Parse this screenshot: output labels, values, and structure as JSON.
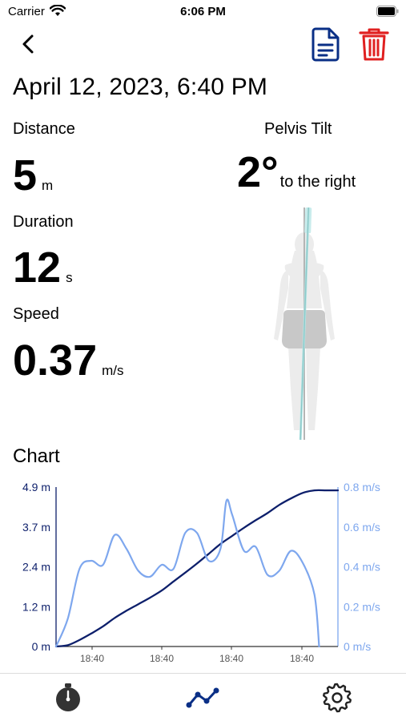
{
  "status_bar": {
    "carrier": "Carrier",
    "time": "6:06 PM"
  },
  "header": {
    "back_icon": "chevron-left-icon",
    "doc_icon": "document-icon",
    "delete_icon": "trash-icon",
    "delete_color": "#e02020",
    "doc_color": "#0a2f86"
  },
  "title": "April 12, 2023, 6:40 PM",
  "stats": {
    "distance": {
      "label": "Distance",
      "value": "5",
      "unit": "m"
    },
    "duration": {
      "label": "Duration",
      "value": "12",
      "unit": "s"
    },
    "speed": {
      "label": "Speed",
      "value": "0.37",
      "unit": "m/s"
    }
  },
  "pelvis": {
    "label": "Pelvis Tilt",
    "value": "2°",
    "direction": "to the right",
    "tilt_deg": 2
  },
  "chart_section": {
    "label": "Chart"
  },
  "chart_data": {
    "type": "line",
    "x_tick_labels": [
      "18:40",
      "18:40",
      "18:40",
      "18:40"
    ],
    "left_axis": {
      "ticks": [
        "0 m",
        "1.2 m",
        "2.4 m",
        "3.7 m",
        "4.9 m"
      ],
      "ylim": [
        0,
        4.9
      ]
    },
    "right_axis": {
      "ticks": [
        "0 m/s",
        "0.2 m/s",
        "0.4 m/s",
        "0.6 m/s",
        "0.8 m/s"
      ],
      "ylim": [
        0,
        0.8
      ]
    },
    "xlim": [
      0,
      12
    ],
    "series": [
      {
        "color": "#0d1f6b",
        "axis": "left",
        "x": [
          0,
          0.5,
          1,
          1.5,
          2,
          2.5,
          3,
          3.5,
          4,
          4.5,
          5,
          5.5,
          6,
          6.5,
          7,
          7.5,
          8,
          8.5,
          9,
          9.5,
          10,
          10.5,
          11,
          11.5,
          12
        ],
        "y": [
          0,
          0.04,
          0.2,
          0.4,
          0.62,
          0.88,
          1.1,
          1.3,
          1.5,
          1.72,
          2.0,
          2.27,
          2.55,
          2.85,
          3.15,
          3.4,
          3.65,
          3.88,
          4.1,
          4.35,
          4.55,
          4.72,
          4.8,
          4.8,
          4.8
        ]
      },
      {
        "color": "#7ea7ee",
        "axis": "right",
        "x": [
          0,
          0.5,
          1,
          1.5,
          2,
          2.5,
          3,
          3.5,
          4,
          4.5,
          5,
          5.5,
          6,
          6.5,
          7,
          7.25,
          7.5,
          8,
          8.5,
          9,
          9.5,
          10,
          10.5,
          11,
          11.2
        ],
        "y": [
          0,
          0.14,
          0.39,
          0.43,
          0.41,
          0.56,
          0.49,
          0.38,
          0.35,
          0.41,
          0.39,
          0.57,
          0.57,
          0.43,
          0.49,
          0.73,
          0.66,
          0.48,
          0.5,
          0.36,
          0.38,
          0.48,
          0.42,
          0.26,
          0
        ]
      }
    ]
  },
  "tab_bar": {
    "items": [
      {
        "name": "stopwatch-icon"
      },
      {
        "name": "chart-line-icon",
        "active": true,
        "color": "#0a2f86"
      },
      {
        "name": "gear-icon"
      }
    ]
  }
}
